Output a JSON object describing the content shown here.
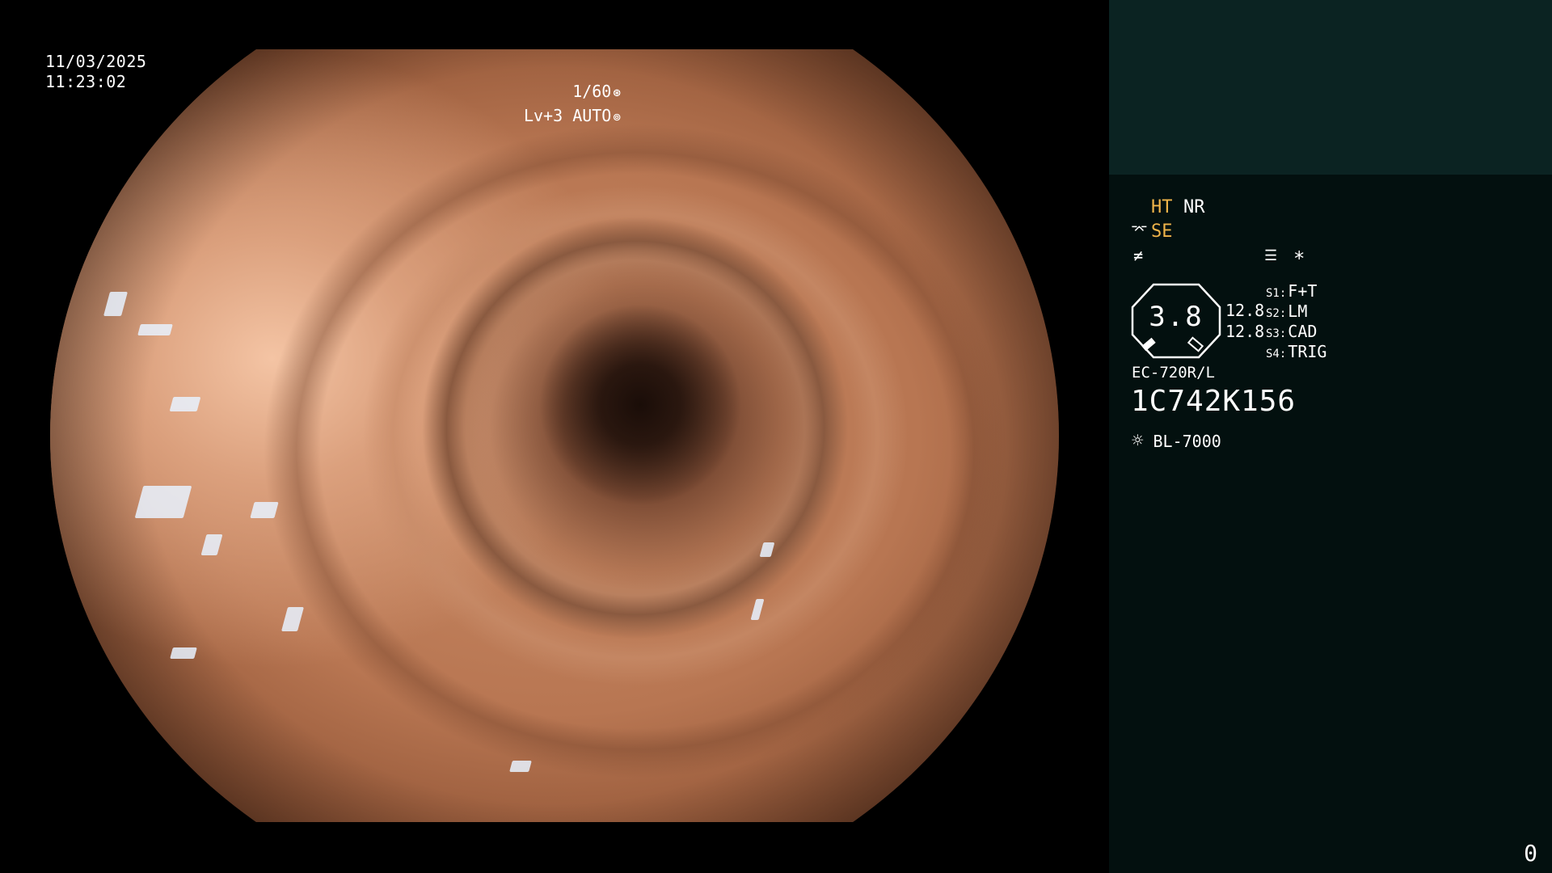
{
  "datetime": {
    "date": "11/03/2025",
    "time": "11:23:02"
  },
  "camera": {
    "shutter": "1/60",
    "level": "Lv+3",
    "iris_mode": "AUTO",
    "shutter_icon": "aperture-icon",
    "iris_icon": "iris-icon"
  },
  "panel": {
    "ht": "HT",
    "nr": "NR",
    "se": "SE",
    "se_icon": "enhance-icon",
    "filter_icon": "slash-icon",
    "menu_icon": "list-icon",
    "star": "*",
    "gauge_value": "3.8",
    "gauge_left": "12.8",
    "gauge_right": "12.8",
    "switches": [
      {
        "key": "S1:",
        "value": "F+T"
      },
      {
        "key": "S2:",
        "value": "LM"
      },
      {
        "key": "S3:",
        "value": "CAD"
      },
      {
        "key": "S4:",
        "value": "TRIG"
      }
    ],
    "scope_model": "EC-720R/L",
    "scope_serial": "1C742K156",
    "light_source": "BL-7000",
    "light_icon": "sun-icon"
  },
  "counter": "0",
  "colors": {
    "highlight": "#f0b44a",
    "panel_bg": "#03100f",
    "panel_top": "#0b2322"
  }
}
